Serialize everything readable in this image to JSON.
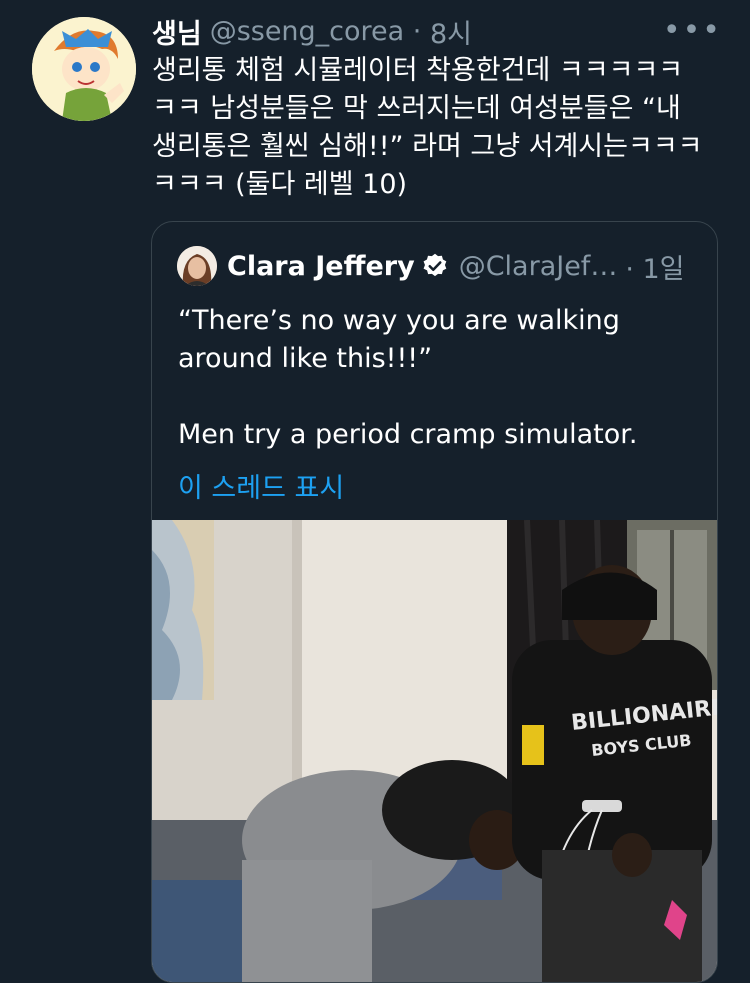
{
  "tweet": {
    "display_name": "생님",
    "handle": "@sseng_corea",
    "time": "8시",
    "text_lines": [
      "생리통 체험 시뮬레이터 착용한건데 ㅋㅋㅋㅋㅋ",
      "ㅋㅋ 남성분들은 막 쓰러지는데 여성분들은 “내",
      "생리통은 훨씬 심해!!” 라며 그냥 서계시는ㅋㅋㅋ",
      "ㅋㅋㅋ (둘다 레벨 10)"
    ],
    "more_icon": "more-dots-icon"
  },
  "quote": {
    "display_name": "Clara Jeffery",
    "handle": "@ClaraJef…",
    "time": "· 1일",
    "verified_icon": "verified-badge-icon",
    "text_lines": [
      "“There’s no way you are walking",
      "around like this!!!”",
      "",
      "Men try a period cramp simulator."
    ],
    "show_thread": "이 스레드 표시"
  },
  "colors": {
    "background": "#15202b",
    "text": "#ffffff",
    "muted": "#8899a6",
    "link": "#1da1f2",
    "border": "#38444d"
  }
}
